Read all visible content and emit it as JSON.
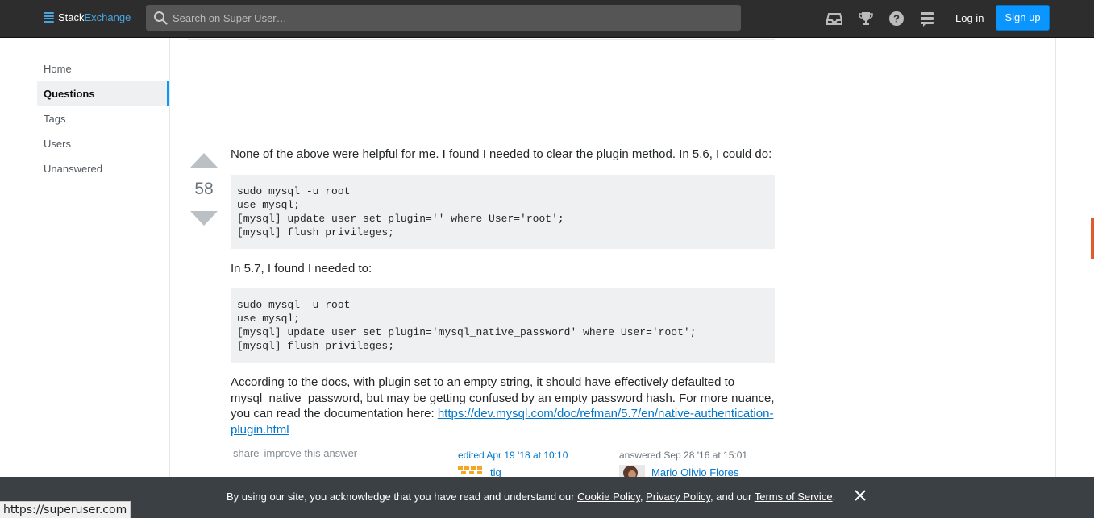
{
  "header": {
    "logo_stack": "Stack",
    "logo_exchange": "Exchange",
    "search_placeholder": "Search on Super User…",
    "icons": [
      "inbox-icon",
      "achievements-icon",
      "help-icon",
      "site-switcher-icon"
    ],
    "login_label": "Log in",
    "signup_label": "Sign up",
    "colors": {
      "bar": "#2d2d2d",
      "accent": "#0a95ff"
    }
  },
  "sidebar": {
    "items": [
      {
        "label": "Home",
        "active": false
      },
      {
        "label": "Questions",
        "active": true
      },
      {
        "label": "Tags",
        "active": false
      },
      {
        "label": "Users",
        "active": false
      },
      {
        "label": "Unanswered",
        "active": false
      }
    ]
  },
  "answer": {
    "vote_count": "58",
    "intro": "None of the above were helpful for me. I found I needed to clear the plugin method. In 5.6, I could do:",
    "code_56": "sudo mysql -u root\nuse mysql;\n[mysql] update user set plugin='' where User='root';\n[mysql] flush privileges;",
    "text_57": "In 5.7, I found I needed to:",
    "code_57": "sudo mysql -u root\nuse mysql;\n[mysql] update user set plugin='mysql_native_password' where User='root';\n[mysql] flush privileges;",
    "docs_text": "According to the docs, with plugin set to an empty string, it should have effectively defaulted to mysql_native_password, but may be getting confused by an empty password hash. For more nuance, you can read the documentation here: ",
    "docs_link": "https://dev.mysql.com/doc/refman/5.7/en/native-authentication-plugin.html",
    "menu_share": "share",
    "menu_improve": "improve this answer",
    "edited": "edited Apr 19 '18 at 10:10",
    "editor_name": "tig",
    "answered": "answered Sep 28 '16 at 15:01",
    "author_name": "Mario Olivio Flores"
  },
  "cookie_banner": {
    "prefix": "By using our site, you acknowledge that you have read and understand our ",
    "cookie_policy": "Cookie Policy",
    "sep1": ", ",
    "privacy_policy": "Privacy Policy",
    "sep2": ", and our ",
    "terms": "Terms of Service",
    "suffix": "."
  },
  "status_bar_url": "https://superuser.com"
}
